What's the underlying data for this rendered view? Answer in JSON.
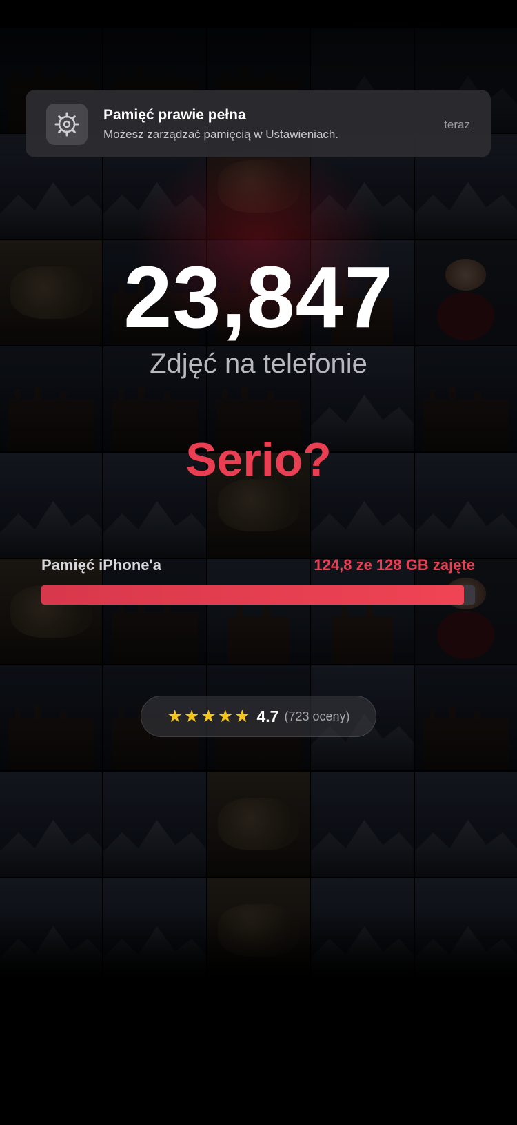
{
  "notification": {
    "icon": "gear-icon",
    "title": "Pamięć prawie pełna",
    "body": "Możesz zarządzać pamięcią w Ustawieniach.",
    "time": "teraz"
  },
  "hero": {
    "count": "23,847",
    "subtitle": "Zdjęć na telefonie",
    "headline": "Serio?"
  },
  "storage": {
    "label": "Pamięć iPhone'a",
    "value_text": "124,8 ze 128 GB zajęte",
    "used_gb": 124.8,
    "total_gb": 128
  },
  "rating": {
    "stars": "★★★★★",
    "star_count": 5,
    "value": "4.7",
    "count_text": "(723 oceny)"
  },
  "colors": {
    "accent_red": "#ea3f52",
    "star_yellow": "#f5c518",
    "notification_bg": "#2c2c30"
  },
  "background_tiles": [
    "city",
    "city",
    "city",
    "mount",
    "mount",
    "mount",
    "mount",
    "rock",
    "mount",
    "mount",
    "rock",
    "city",
    "city",
    "church",
    "person",
    "city",
    "city",
    "city",
    "mount",
    "city",
    "mount",
    "mount",
    "rock",
    "mount",
    "mount",
    "rock",
    "city",
    "church",
    "church",
    "person",
    "city",
    "city",
    "city",
    "mount",
    "city",
    "mount",
    "mount",
    "rock",
    "mount",
    "mount",
    "mount",
    "mount",
    "rock",
    "mount",
    "mount"
  ]
}
